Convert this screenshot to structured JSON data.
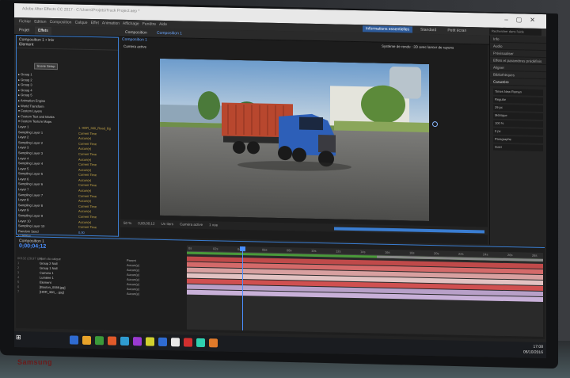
{
  "app": {
    "title": "Adobe After Effects CC 2017 - C:\\Users\\Projets\\Truck Project.aep *",
    "menu": [
      "Fichier",
      "Edition",
      "Composition",
      "Calque",
      "Effet",
      "Animation",
      "Affichage",
      "Fenêtre",
      "Aide"
    ],
    "workspaces": [
      "Informations essentielles",
      "Standard",
      "Petit écran"
    ],
    "active_workspace": "Informations essentielles",
    "search_placeholder": "Rechercher dans l'aide"
  },
  "panels": {
    "project_tab": "Projet",
    "effects_tab": "Effets",
    "composition_tab": "Composition",
    "composition_name": "Composition 1",
    "viewer_camera": "Caméra active",
    "renderer": "Système de rendu : 3D avec lancer de rayons"
  },
  "effects": {
    "header": "Composition 1 • Iniv",
    "plugin": "Element",
    "reset_label": "Scene Setup",
    "rows": [
      {
        "name": "▸ Group 1",
        "value": ""
      },
      {
        "name": "▸ Group 2",
        "value": ""
      },
      {
        "name": "▸ Group 3",
        "value": ""
      },
      {
        "name": "▸ Group 4",
        "value": ""
      },
      {
        "name": "▸ Group 5",
        "value": ""
      },
      {
        "name": "▸ Animation Engine",
        "value": ""
      },
      {
        "name": "▸ World Transform",
        "value": ""
      },
      {
        "name": "▾ Custom Layers",
        "value": ""
      },
      {
        "name": "  ▸ Custom Text and Masks",
        "value": ""
      },
      {
        "name": "  ▾ Custom Texture Maps",
        "value": ""
      },
      {
        "name": "    Layer 1",
        "value": "1. HDR_360_Road_Bg"
      },
      {
        "name": "    Sampling Layer 1",
        "value": "Current Time"
      },
      {
        "name": "    Layer 2",
        "value": "Aucun(e)"
      },
      {
        "name": "    Sampling Layer 2",
        "value": "Current Time"
      },
      {
        "name": "    Layer 3",
        "value": "Aucun(e)"
      },
      {
        "name": "    Sampling Layer 3",
        "value": "Current Time"
      },
      {
        "name": "    Layer 4",
        "value": "Aucun(e)"
      },
      {
        "name": "    Sampling Layer 4",
        "value": "Current Time"
      },
      {
        "name": "    Layer 5",
        "value": "Aucun(e)"
      },
      {
        "name": "    Sampling Layer 5",
        "value": "Current Time"
      },
      {
        "name": "    Layer 6",
        "value": "Aucun(e)"
      },
      {
        "name": "    Sampling Layer 6",
        "value": "Current Time"
      },
      {
        "name": "    Layer 7",
        "value": "Aucun(e)"
      },
      {
        "name": "    Sampling Layer 7",
        "value": "Current Time"
      },
      {
        "name": "    Layer 8",
        "value": "Aucun(e)"
      },
      {
        "name": "    Sampling Layer 8",
        "value": "Current Time"
      },
      {
        "name": "    Layer 9",
        "value": "Aucun(e)"
      },
      {
        "name": "    Sampling Layer 9",
        "value": "Current Time"
      },
      {
        "name": "    Layer 10",
        "value": "Aucun(e)"
      },
      {
        "name": "    Sampling Layer 10",
        "value": "Current Time"
      },
      {
        "name": "    Random Seed",
        "value": "0,00"
      },
      {
        "name": "▸ Utilities",
        "value": ""
      },
      {
        "name": "▸ Render Settings",
        "value": ""
      },
      {
        "name": "▸ Output",
        "value": ""
      }
    ]
  },
  "viewer_footer": {
    "zoom": "50 %",
    "timecode": "0;00;00;12",
    "resolution": "Un tiers",
    "camera": "Caméra active",
    "views": "1 vue"
  },
  "right_panel": {
    "items": [
      "Info",
      "Audio",
      "Prévisualiser",
      "Effets et paramètres prédéfinis",
      "Aligner",
      "Bibliothèques",
      "Caractère"
    ],
    "char_controls": [
      "Times New Roman",
      "Regular",
      "29 px",
      "Métrique",
      "100 %",
      "0 px",
      "Paragraphe",
      "Suivi"
    ]
  },
  "timeline": {
    "tab": "Composition 1",
    "timecode": "0;00;04;12",
    "frame_info": "00132 (29,97 ips)",
    "col_header": "Nom du calque",
    "parent_header": "Parent",
    "layers": [
      {
        "num": "1",
        "name": "Group 2 Null",
        "parent": "Aucun(e)"
      },
      {
        "num": "2",
        "name": "Group 1 Null",
        "parent": "Aucun(e)"
      },
      {
        "num": "3",
        "name": "Camera 1",
        "parent": "Aucun(e)"
      },
      {
        "num": "4",
        "name": "Lumière 1",
        "parent": "Aucun(e)"
      },
      {
        "num": "5",
        "name": "Element",
        "parent": "Aucun(e)"
      },
      {
        "num": "6",
        "name": "[Bouton_0089.jpg]",
        "parent": "Aucun(e)"
      },
      {
        "num": "7",
        "name": "[HDR_360_...jpg]",
        "parent": "Aucun(e)"
      }
    ],
    "ruler_marks": [
      "0s",
      "02s",
      "04s",
      "06s",
      "08s",
      "10s",
      "12s",
      "14s",
      "16s",
      "18s",
      "20s",
      "22s",
      "24s",
      "26s",
      "28s"
    ],
    "bar_colors": [
      "#c04a4a",
      "#d46a6a",
      "#d8a0a0",
      "#e2c2c2",
      "#d05050",
      "#b8a0c8",
      "#c8b0d8"
    ]
  },
  "taskbar": {
    "time": "17:08",
    "date": "06/10/2016",
    "icon_colors": [
      "#2f6bd1",
      "#e8a32a",
      "#3a9a3a",
      "#e05a2a",
      "#2f9bd1",
      "#9a3ad1",
      "#d1d12f",
      "#2f6bd1",
      "#e8e8e8",
      "#d12f2f",
      "#2fd1b0",
      "#e07a2a"
    ]
  },
  "brand": "Samsung"
}
